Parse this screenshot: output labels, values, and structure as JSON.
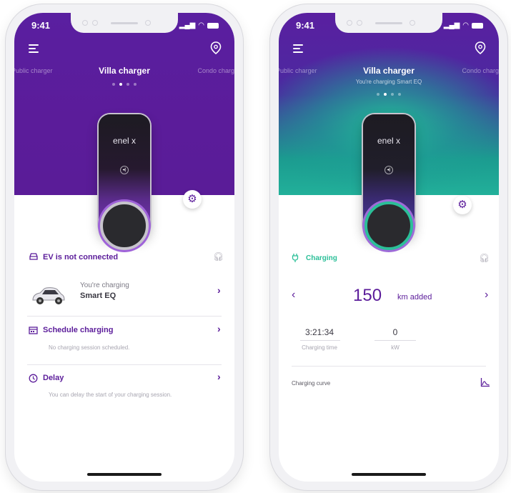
{
  "colors": {
    "brand_purple": "#5b1c9a",
    "charging_green": "#2bbf98",
    "muted": "#a8a6b1"
  },
  "left": {
    "status_time": "9:41",
    "tabs": {
      "prev": "Public charger",
      "active": "Villa charger",
      "next": "Condo charger"
    },
    "charger_logo": "enel x",
    "status": {
      "label": "EV is not connected",
      "icon": "car-outline-icon"
    },
    "vehicle": {
      "line1": "You're charging",
      "line2": "Smart EQ"
    },
    "schedule": {
      "title": "Schedule charging",
      "desc": "No charging session scheduled."
    },
    "delay": {
      "title": "Delay",
      "desc": "You can delay the start of your charging session."
    }
  },
  "right": {
    "status_time": "9:41",
    "tabs": {
      "prev": "Public charger",
      "active": "Villa charger",
      "next": "Condo charger"
    },
    "subtitle": "You're charging Smart EQ",
    "charger_logo": "enel x",
    "status": {
      "label": "Charging",
      "icon": "plug-icon"
    },
    "km_added": {
      "value": "150",
      "label": "km added"
    },
    "stats": [
      {
        "value": "3:21:34",
        "label": "Charging time"
      },
      {
        "value": "0",
        "label": "kW"
      }
    ],
    "curve_label": "Charging curve"
  }
}
